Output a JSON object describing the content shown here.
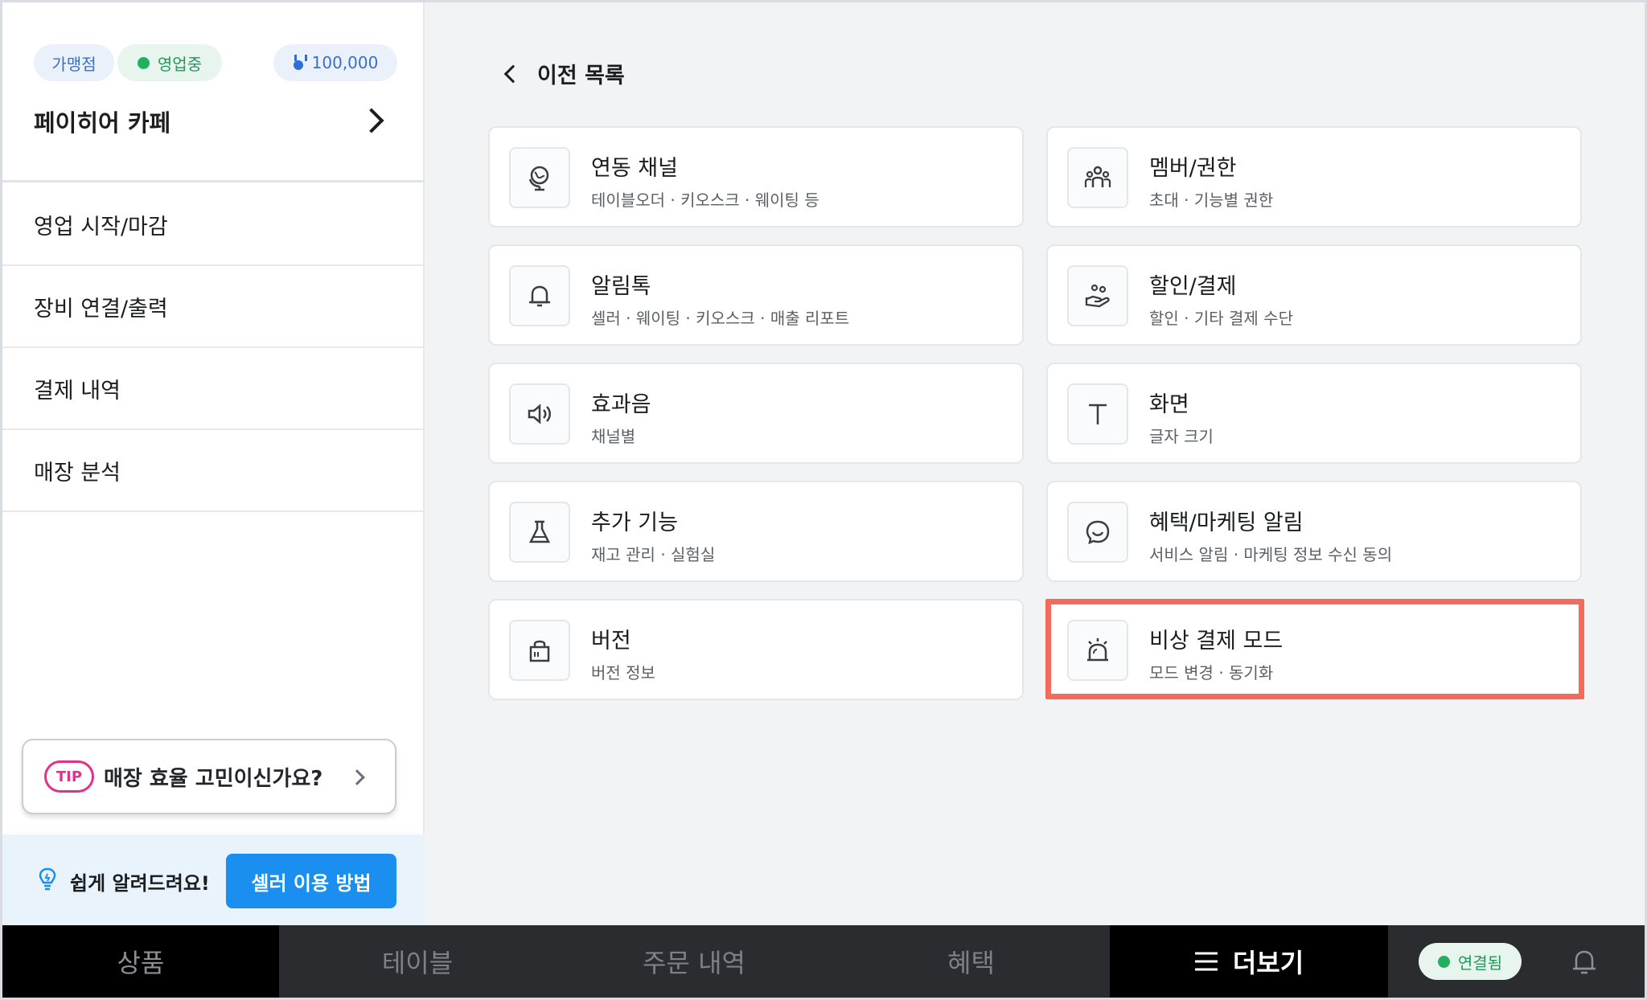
{
  "store": {
    "badge_franchise": "가맹점",
    "badge_status": "영업중",
    "points": "100,000",
    "name": "페이히어 카페"
  },
  "sidebar": {
    "items": [
      {
        "label": "영업 시작/마감"
      },
      {
        "label": "장비 연결/출력"
      },
      {
        "label": "결제 내역"
      },
      {
        "label": "매장 분석"
      }
    ],
    "tip_badge": "TIP",
    "tip_text": "매장 효율 고민이신가요?",
    "help_text": "쉽게 알려드려요!",
    "help_button": "셀러 이용 방법"
  },
  "main": {
    "back_label": "이전 목록",
    "cards": [
      {
        "icon": "globe-icon",
        "title": "연동 채널",
        "subtitle": "테이블오더 · 키오스크 · 웨이팅 등"
      },
      {
        "icon": "members-icon",
        "title": "멤버/권한",
        "subtitle": "초대 · 기능별 권한"
      },
      {
        "icon": "bell-icon",
        "title": "알림톡",
        "subtitle": "셀러 · 웨이팅 · 키오스크 · 매출 리포트"
      },
      {
        "icon": "discount-hand-icon",
        "title": "할인/결제",
        "subtitle": "할인 · 기타 결제 수단"
      },
      {
        "icon": "speaker-icon",
        "title": "효과음",
        "subtitle": "채널별"
      },
      {
        "icon": "text-size-icon",
        "title": "화면",
        "subtitle": "글자 크기"
      },
      {
        "icon": "flask-icon",
        "title": "추가 기능",
        "subtitle": "재고 관리 · 실험실"
      },
      {
        "icon": "chat-smile-icon",
        "title": "혜택/마케팅 알림",
        "subtitle": "서비스 알림 · 마케팅 정보 수신 동의"
      },
      {
        "icon": "lock-bag-icon",
        "title": "버전",
        "subtitle": "버전 정보"
      },
      {
        "icon": "siren-icon",
        "title": "비상 결제 모드",
        "subtitle": "모드 변경 · 동기화"
      }
    ]
  },
  "bottom_nav": {
    "tabs": [
      {
        "label": "상품"
      },
      {
        "label": "테이블"
      },
      {
        "label": "주문 내역"
      },
      {
        "label": "혜택"
      },
      {
        "label": "더보기"
      }
    ],
    "connection": "연결됨"
  },
  "colors": {
    "accent_blue": "#1a8ff0",
    "status_green": "#20b15e",
    "tip_pink": "#e2318a",
    "highlight": "#f26b5c"
  }
}
